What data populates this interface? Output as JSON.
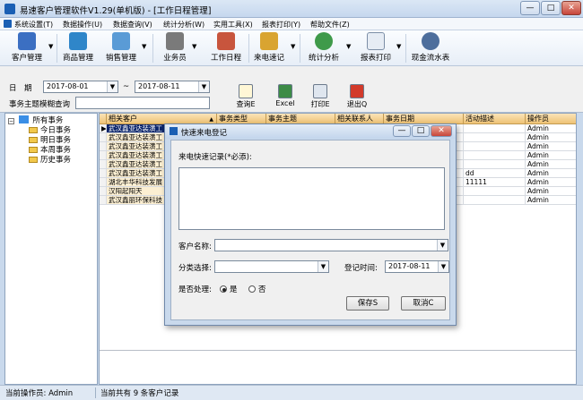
{
  "app": {
    "title": "易速客户管理软件V1.29(单机版) - [工作日程管理]"
  },
  "window_buttons": {
    "minimize": "—",
    "maximize": "□",
    "close": "✕"
  },
  "menubar": {
    "items": [
      "系统设置(T)",
      "数据操作(U)",
      "数据查询(V)",
      "统计分析(W)",
      "实用工具(X)",
      "报表打印(Y)",
      "帮助文件(Z)"
    ]
  },
  "toolbar": {
    "items": [
      {
        "label": "客户管理",
        "icon": "client-icon"
      },
      {
        "label": "商品管理",
        "icon": "product-icon"
      },
      {
        "label": "销售管理",
        "icon": "sales-icon"
      },
      {
        "label": "业务员",
        "icon": "staff-icon"
      },
      {
        "label": "工作日程",
        "icon": "schedule-icon"
      },
      {
        "label": "来电速记",
        "icon": "call-note-icon"
      },
      {
        "label": "统计分析",
        "icon": "stats-icon"
      },
      {
        "label": "报表打印",
        "icon": "report-icon"
      },
      {
        "label": "现金流水表",
        "icon": "cashflow-icon"
      }
    ],
    "dropdown_glyph": "▼"
  },
  "search": {
    "date_label": "日　期",
    "date_from": "2017-08-01",
    "date_sep": "~",
    "date_to": "2017-08-11",
    "topic_label": "事务主题模糊查询",
    "topic_value": "",
    "buttons": [
      {
        "label": "查询E"
      },
      {
        "label": "Excel"
      },
      {
        "label": "打印E"
      },
      {
        "label": "退出Q"
      }
    ]
  },
  "tree": {
    "root": "所有事务",
    "children": [
      "今日事务",
      "明日事务",
      "本周事务",
      "历史事务"
    ]
  },
  "grid": {
    "columns": [
      "相关客户",
      "事务类型",
      "事务主题",
      "相关联系人",
      "事务日期",
      "活动描述",
      "操作员"
    ],
    "rows": [
      [
        "武汉鑫亚达装潢工",
        "",
        "",
        "",
        "",
        "",
        "Admin"
      ],
      [
        "武汉鑫亚达装潢工",
        "",
        "",
        "",
        "",
        "",
        "Admin"
      ],
      [
        "武汉鑫亚达装潢工",
        "",
        "",
        "",
        "",
        "",
        "Admin"
      ],
      [
        "武汉鑫亚达装潢工",
        "",
        "",
        "",
        "",
        "",
        "Admin"
      ],
      [
        "武汉鑫亚达装潢工",
        "",
        "",
        "",
        "",
        "",
        "Admin"
      ],
      [
        "武汉鑫亚达装潢工",
        "",
        "",
        "",
        "",
        "dd",
        "Admin"
      ],
      [
        "湖北丰华科技发展",
        "",
        "",
        "",
        "",
        "11111",
        "Admin"
      ],
      [
        "汉阳起阳天",
        "",
        "",
        "",
        "",
        "",
        "Admin"
      ],
      [
        "武汉鑫丽环保科技",
        "",
        "",
        "",
        "",
        "",
        "Admin"
      ]
    ],
    "sort_glyph": "▲"
  },
  "status": {
    "operator": "当前操作员: Admin",
    "count": "当前共有 9 条客户记录"
  },
  "modal": {
    "title": "快速来电登记",
    "record_label": "来电快速记录(*必添):",
    "record_value": "",
    "client_label": "客户名称:",
    "client_value": "",
    "category_label": "分类选择:",
    "category_value": "",
    "time_label": "登记时间:",
    "time_value": "2017-08-11",
    "processed_label": "是否处理:",
    "option_yes": "是",
    "option_no": "否",
    "save_label": "保存S",
    "cancel_label": "取消C"
  },
  "colors": {
    "accent": "#1a5fb4",
    "header": "#eec275",
    "selected_row": "#0a246a"
  }
}
